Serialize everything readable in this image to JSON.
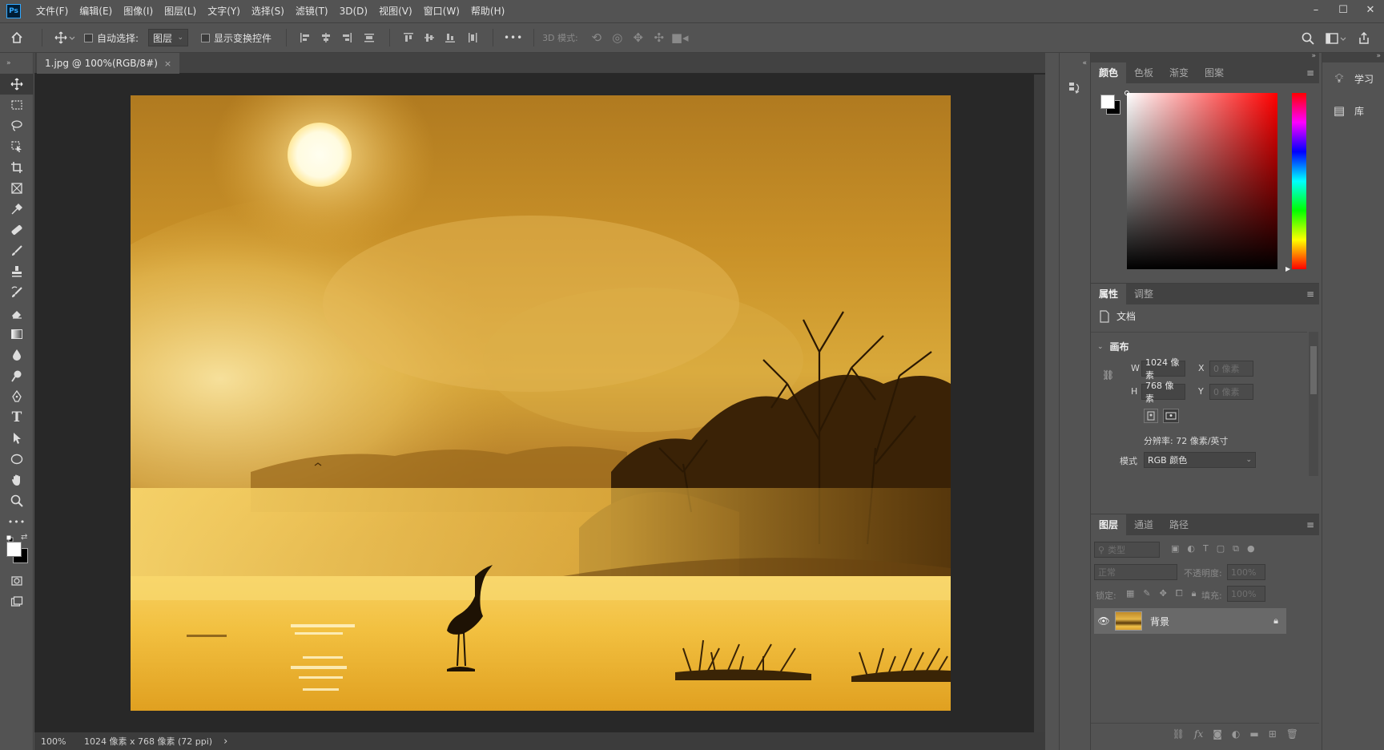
{
  "app": {
    "logo": "Ps"
  },
  "menu": [
    "文件(F)",
    "编辑(E)",
    "图像(I)",
    "图层(L)",
    "文字(Y)",
    "选择(S)",
    "滤镜(T)",
    "3D(D)",
    "视图(V)",
    "窗口(W)",
    "帮助(H)"
  ],
  "window_controls": {
    "minimize": "–",
    "maximize": "☐",
    "close": "✕"
  },
  "options": {
    "auto_select_label": "自动选择:",
    "auto_select_value": "图层",
    "show_transform_label": "显示变换控件",
    "more": "•••",
    "mode_3d_label": "3D 模式:"
  },
  "document": {
    "tab_title": "1.jpg @ 100%(RGB/8#)",
    "tab_close": "×"
  },
  "status": {
    "zoom": "100%",
    "info": "1024 像素 x 768 像素 (72 ppi)",
    "arrow": "›"
  },
  "color_panel": {
    "tabs": [
      "颜色",
      "色板",
      "渐变",
      "图案"
    ],
    "active": 0,
    "hue_color": "#ff0000"
  },
  "properties_panel": {
    "tabs": [
      "属性",
      "调整"
    ],
    "active": 0,
    "doc_label": "文档",
    "section": "画布",
    "w_label": "W",
    "w_value": "1024 像素",
    "h_label": "H",
    "h_value": "768 像素",
    "x_label": "X",
    "x_placeholder": "0 像素",
    "y_label": "Y",
    "y_placeholder": "0 像素",
    "resolution": "分辨率: 72 像素/英寸",
    "mode_label": "模式",
    "mode_value": "RGB 颜色"
  },
  "layers_panel": {
    "tabs": [
      "图层",
      "通道",
      "路径"
    ],
    "active": 0,
    "filter_placeholder": "类型",
    "blend_mode": "正常",
    "opacity_label": "不透明度:",
    "opacity_value": "100%",
    "lock_label": "锁定:",
    "fill_label": "填充:",
    "fill_value": "100%",
    "layers": [
      {
        "name": "背景",
        "visible": true,
        "locked": true
      }
    ]
  },
  "far_panel": {
    "items": [
      {
        "icon": "lightbulb-icon",
        "label": "学习"
      },
      {
        "icon": "library-icon",
        "label": "库"
      }
    ]
  }
}
